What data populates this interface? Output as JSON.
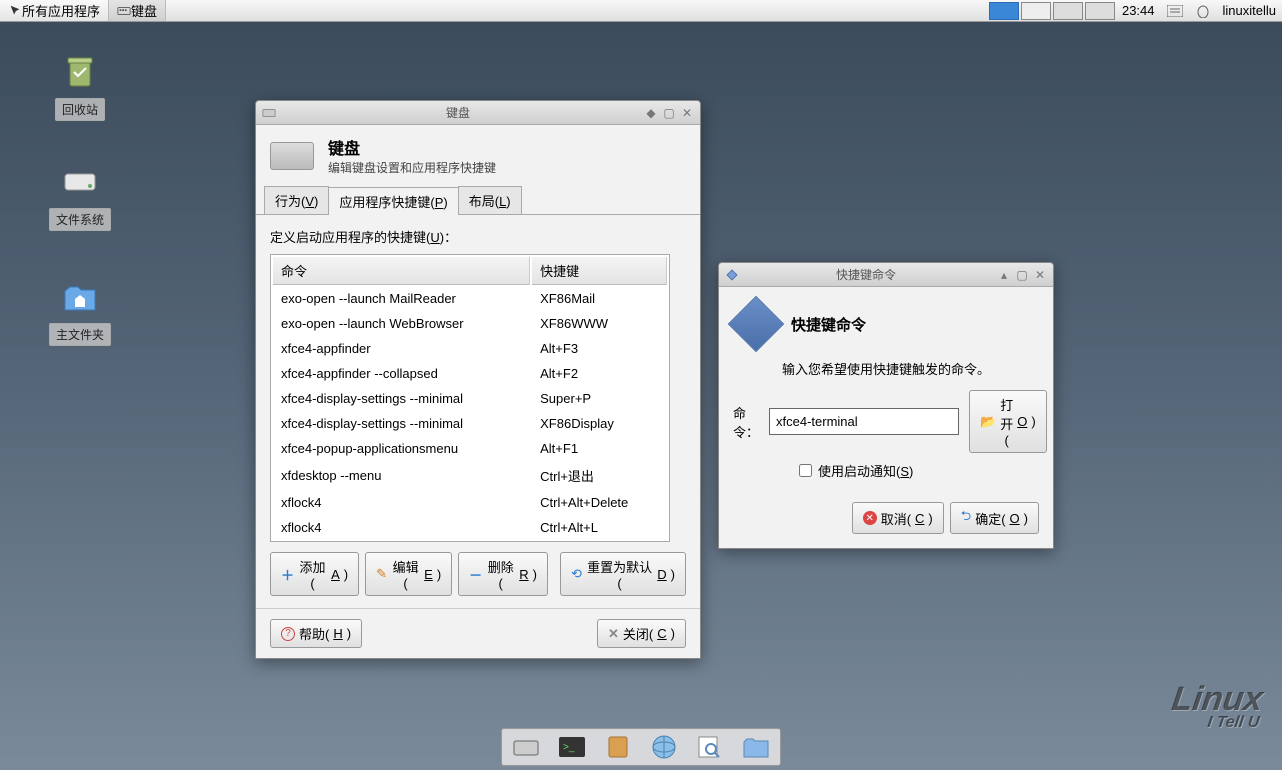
{
  "panel": {
    "apps_btn": "所有应用程序",
    "task_btn": "键盘",
    "clock": "23:44",
    "user": "linuxitellu"
  },
  "desktop": {
    "trash": "回收站",
    "filesystem": "文件系统",
    "home": "主文件夹"
  },
  "kb_window": {
    "title": "键盘",
    "heading": "键盘",
    "subheading": "编辑键盘设置和应用程序快捷键",
    "tab_behavior": "行为(V)",
    "tab_shortcuts": "应用程序快捷键(P)",
    "tab_layout": "布局(L)",
    "define_label": "定义启动应用程序的快捷键(U)：",
    "col_cmd": "命令",
    "col_key": "快捷键",
    "shortcuts": [
      {
        "cmd": "exo-open --launch MailReader",
        "key": "XF86Mail"
      },
      {
        "cmd": "exo-open --launch WebBrowser",
        "key": "XF86WWW"
      },
      {
        "cmd": "xfce4-appfinder",
        "key": "Alt+F3"
      },
      {
        "cmd": "xfce4-appfinder --collapsed",
        "key": "Alt+F2"
      },
      {
        "cmd": "xfce4-display-settings --minimal",
        "key": "Super+P"
      },
      {
        "cmd": "xfce4-display-settings --minimal",
        "key": "XF86Display"
      },
      {
        "cmd": "xfce4-popup-applicationsmenu",
        "key": "Alt+F1"
      },
      {
        "cmd": "xfdesktop --menu",
        "key": "Ctrl+退出"
      },
      {
        "cmd": "xflock4",
        "key": "Ctrl+Alt+Delete"
      },
      {
        "cmd": "xflock4",
        "key": "Ctrl+Alt+L"
      }
    ],
    "btn_add": "添加(A)",
    "btn_edit": "编辑(E)",
    "btn_remove": "删除(R)",
    "btn_reset": "重置为默认(D)",
    "btn_help": "帮助(H)",
    "btn_close": "关闭(C)"
  },
  "sc_dialog": {
    "title": "快捷键命令",
    "heading": "快捷键命令",
    "instruction": "输入您希望使用快捷键触发的命令。",
    "cmd_label": "命令：",
    "cmd_value": "xfce4-terminal",
    "btn_open": "打开(O)",
    "chk_notify": "使用启动通知(S)",
    "btn_cancel": "取消(C)",
    "btn_ok": "确定(O)"
  },
  "watermark": {
    "main": "Linux",
    "sub": "I Tell U"
  }
}
